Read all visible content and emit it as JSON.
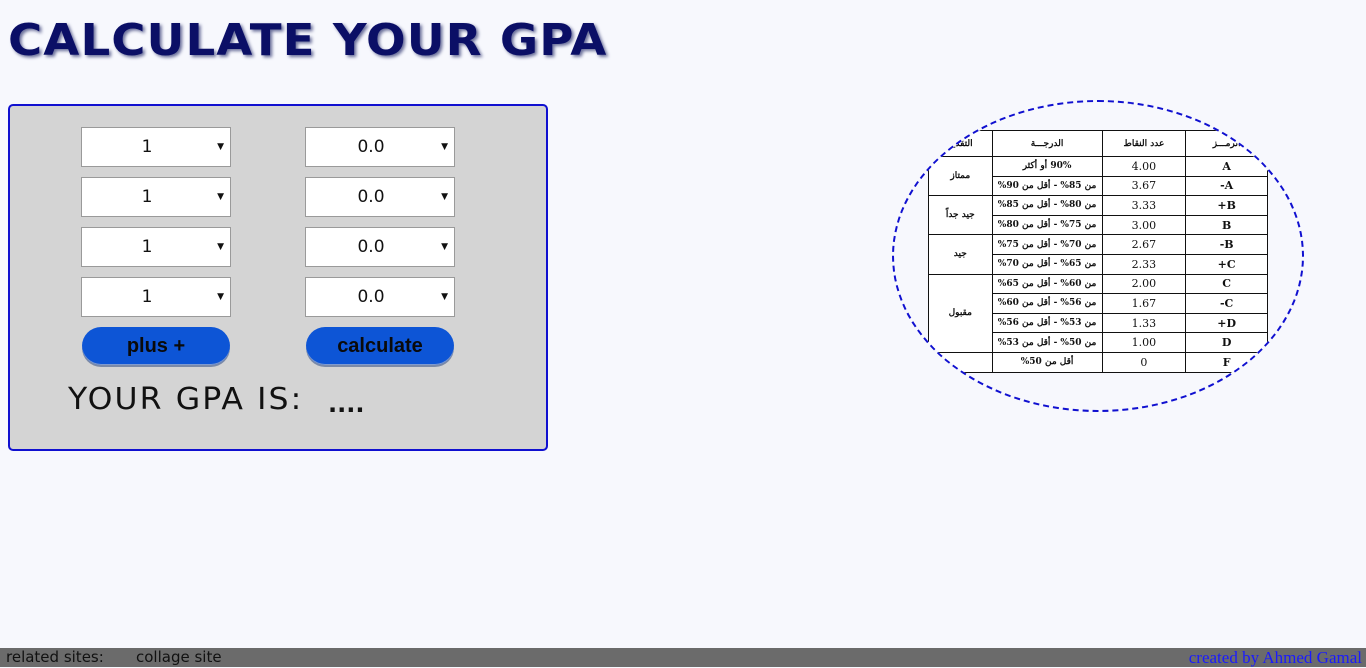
{
  "page": {
    "title": "CALCULATE YOUR GPA"
  },
  "calculator": {
    "rows": [
      {
        "hours": "1",
        "grade": "0.0"
      },
      {
        "hours": "1",
        "grade": "0.0"
      },
      {
        "hours": "1",
        "grade": "0.0"
      },
      {
        "hours": "1",
        "grade": "0.0"
      }
    ],
    "plus_label": "plus +",
    "calculate_label": "calculate",
    "result_label": "YOUR GPA IS:",
    "result_value": "...."
  },
  "grade_table": {
    "headers": {
      "symbol": "الرمـــز",
      "points": "عدد النقاط",
      "range": "الدرجـــة",
      "rating": "التقدير"
    },
    "rows": [
      {
        "symbol": "A",
        "points": "4.00",
        "range": "90% أو أكثر"
      },
      {
        "symbol": "A-",
        "points": "3.67",
        "range": "من 85% - أقل من 90%"
      },
      {
        "symbol": "B+",
        "points": "3.33",
        "range": "من 80% - أقل من 85%"
      },
      {
        "symbol": "B",
        "points": "3.00",
        "range": "من 75% - أقل من 80%"
      },
      {
        "symbol": "B-",
        "points": "2.67",
        "range": "من 70% - أقل من 75%"
      },
      {
        "symbol": "C+",
        "points": "2.33",
        "range": "من 65% - أقل من 70%"
      },
      {
        "symbol": "C",
        "points": "2.00",
        "range": "من 60% - أقل من 65%"
      },
      {
        "symbol": "C-",
        "points": "1.67",
        "range": "من 56% - أقل من 60%"
      },
      {
        "symbol": "D+",
        "points": "1.33",
        "range": "من 53% - أقل من 56%"
      },
      {
        "symbol": "D",
        "points": "1.00",
        "range": "من 50% - أقل من 53%"
      },
      {
        "symbol": "F",
        "points": "0",
        "range": "أقل من 50%"
      }
    ],
    "ratings": [
      "ممتاز",
      "جيد جداً",
      "جيد",
      "مقبول"
    ]
  },
  "footer": {
    "related_label": "related sites:",
    "college_link": "collage site",
    "credit": "created by Ahmed Gamal"
  },
  "colors": {
    "title": "#0b0f66",
    "button": "#0d55d6",
    "panel_border": "#1010d0",
    "credit": "#1a1aff"
  }
}
